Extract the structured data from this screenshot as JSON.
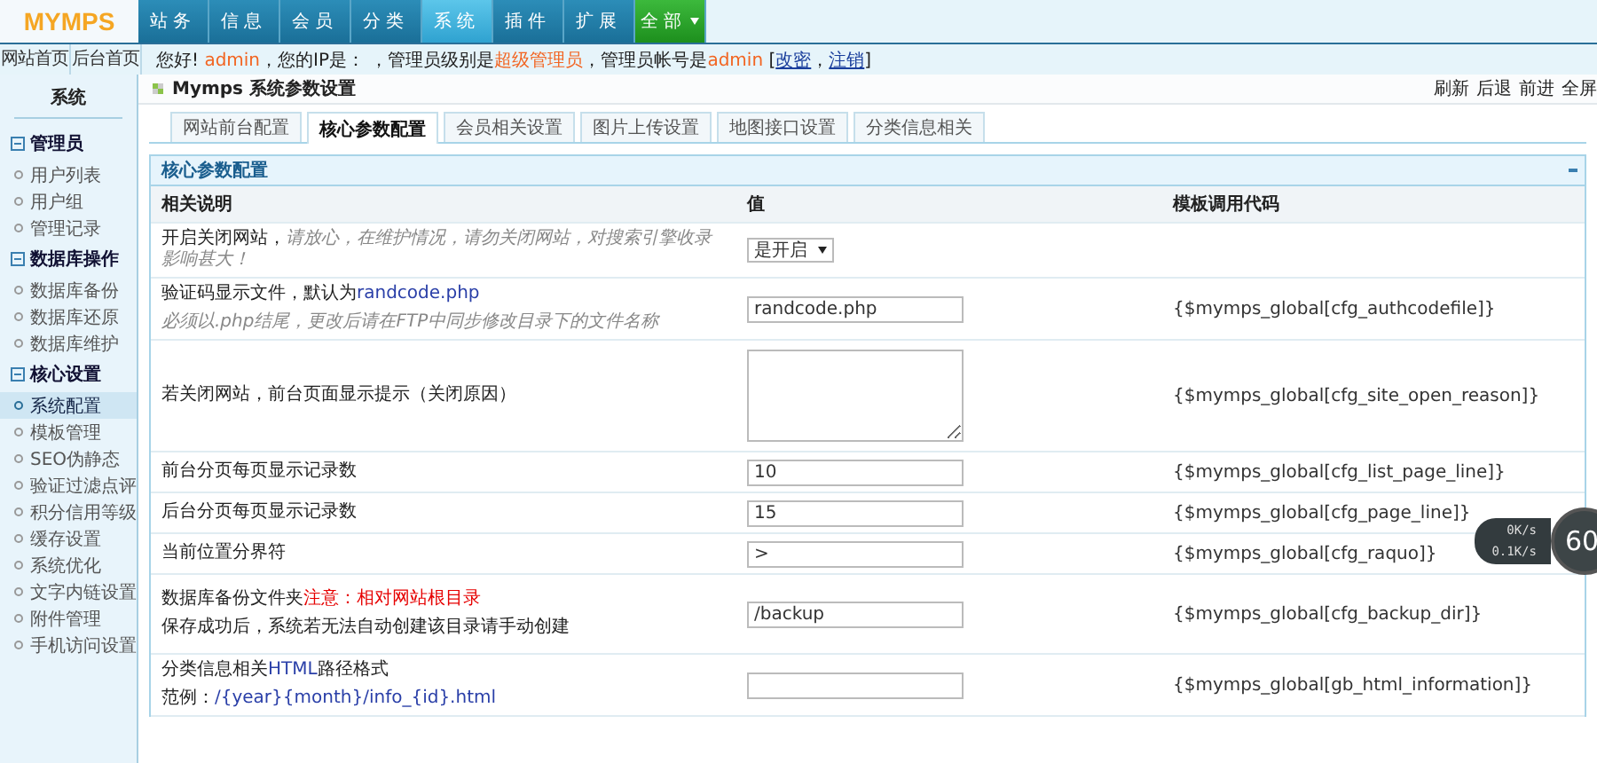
{
  "logo": "MYMPS",
  "nav": [
    {
      "label": "站务",
      "selected": false,
      "kind": "tab"
    },
    {
      "label": "信息",
      "selected": false,
      "kind": "tab"
    },
    {
      "label": "会员",
      "selected": false,
      "kind": "tab"
    },
    {
      "label": "分类",
      "selected": false,
      "kind": "tab"
    },
    {
      "label": "系统",
      "selected": true,
      "kind": "tab"
    },
    {
      "label": "插件",
      "selected": false,
      "kind": "tab"
    },
    {
      "label": "扩展",
      "selected": false,
      "kind": "tab"
    },
    {
      "label": "全部",
      "selected": false,
      "kind": "dropdown"
    }
  ],
  "quick_links": [
    "网站首页",
    "后台首页"
  ],
  "user_bar": [
    {
      "text": "您好! ",
      "kind": "plain"
    },
    {
      "text": "admin",
      "kind": "orange"
    },
    {
      "text": "，您的IP是： ",
      "kind": "plain"
    },
    {
      "text": "，管理员级别是",
      "kind": "plain"
    },
    {
      "text": "超级管理员",
      "kind": "orange"
    },
    {
      "text": "，管理员帐号是",
      "kind": "plain"
    },
    {
      "text": "admin",
      "kind": "orange"
    },
    {
      "text": " [",
      "kind": "plain"
    },
    {
      "text": "改密",
      "kind": "link"
    },
    {
      "text": "，",
      "kind": "plain"
    },
    {
      "text": "注销",
      "kind": "link"
    },
    {
      "text": "]",
      "kind": "plain"
    }
  ],
  "sidebar": {
    "title": "系统",
    "groups": [
      {
        "label": "管理员",
        "expanded": true,
        "items": [
          {
            "label": "用户列表",
            "selected": false
          },
          {
            "label": "用户组",
            "selected": false
          },
          {
            "label": "管理记录",
            "selected": false
          }
        ]
      },
      {
        "label": "数据库操作",
        "expanded": true,
        "items": [
          {
            "label": "数据库备份",
            "selected": false
          },
          {
            "label": "数据库还原",
            "selected": false
          },
          {
            "label": "数据库维护",
            "selected": false
          }
        ]
      },
      {
        "label": "核心设置",
        "expanded": true,
        "items": [
          {
            "label": "系统配置",
            "selected": true
          },
          {
            "label": "模板管理",
            "selected": false
          },
          {
            "label": "SEO伪静态",
            "selected": false
          },
          {
            "label": "验证过滤点评",
            "selected": false
          },
          {
            "label": "积分信用等级",
            "selected": false
          },
          {
            "label": "缓存设置",
            "selected": false
          },
          {
            "label": "系统优化",
            "selected": false
          },
          {
            "label": "文字内链设置",
            "selected": false
          },
          {
            "label": "附件管理",
            "selected": false
          },
          {
            "label": "手机访问设置",
            "selected": false
          }
        ]
      }
    ]
  },
  "page_title": "Mymps 系统参数设置",
  "toolbar": [
    "刷新",
    "后退",
    "前进",
    "全屏"
  ],
  "tabs": [
    {
      "label": "网站前台配置",
      "selected": false
    },
    {
      "label": "核心参数配置",
      "selected": true
    },
    {
      "label": "会员相关设置",
      "selected": false
    },
    {
      "label": "图片上传设置",
      "selected": false
    },
    {
      "label": "地图接口设置",
      "selected": false
    },
    {
      "label": "分类信息相关",
      "selected": false
    }
  ],
  "section": {
    "title": "核心参数配置"
  },
  "columns": [
    "相关说明",
    "值",
    "模板调用代码"
  ],
  "rows": [
    {
      "kind": "select",
      "label": [
        {
          "text": "开启关闭网站，",
          "kind": "plain"
        },
        {
          "text": "请放心，在维护情况，请勿关闭网站，对搜索引擎收录影响甚大！",
          "kind": "hint"
        }
      ],
      "value": "是开启",
      "code": ""
    },
    {
      "kind": "input",
      "label": [
        {
          "text": "验证码显示文件，默认为",
          "kind": "plain"
        },
        {
          "text": "randcode.php",
          "kind": "blue"
        }
      ],
      "note": [
        {
          "text": "必须以.php结尾，更改后请在FTP中同步修改目录下的文件名称",
          "kind": "hint"
        }
      ],
      "value": "randcode.php",
      "code": "{$mymps_global[cfg_authcodefile]}"
    },
    {
      "kind": "textarea",
      "label": [
        {
          "text": "若关闭网站，前台页面显示提示（关闭原因）",
          "kind": "plain"
        }
      ],
      "value": "",
      "code": "{$mymps_global[cfg_site_open_reason]}"
    },
    {
      "kind": "input",
      "label": [
        {
          "text": "前台分页每页显示记录数",
          "kind": "plain"
        }
      ],
      "value": "10",
      "code": "{$mymps_global[cfg_list_page_line]}"
    },
    {
      "kind": "input",
      "label": [
        {
          "text": "后台分页每页显示记录数",
          "kind": "plain"
        }
      ],
      "value": "15",
      "code": "{$mymps_global[cfg_page_line]}"
    },
    {
      "kind": "input",
      "label": [
        {
          "text": "当前位置分界符",
          "kind": "plain"
        }
      ],
      "value": ">",
      "code": "{$mymps_global[cfg_raquo]}"
    },
    {
      "kind": "input",
      "label": [
        {
          "text": "数据库备份文件夹",
          "kind": "plain"
        },
        {
          "text": "注意：相对网站根目录",
          "kind": "red"
        }
      ],
      "note": [
        {
          "text": "保存成功后，系统若无法自动创建该目录请手动创建",
          "kind": "plain"
        }
      ],
      "value": "/backup",
      "code": "{$mymps_global[cfg_backup_dir]}"
    },
    {
      "kind": "input",
      "label": [
        {
          "text": "分类信息相关",
          "kind": "plain"
        },
        {
          "text": "HTML",
          "kind": "blue"
        },
        {
          "text": "路径格式",
          "kind": "plain"
        }
      ],
      "note": [
        {
          "text": "范例：",
          "kind": "plain"
        },
        {
          "text": "/{year}{month}/info_{id}.html",
          "kind": "blue"
        }
      ],
      "value": "",
      "code": "{$mymps_global[gb_html_information]}"
    }
  ],
  "speed_widget": {
    "number": "60",
    "down": "0K/s",
    "up": "0.1K/s"
  }
}
